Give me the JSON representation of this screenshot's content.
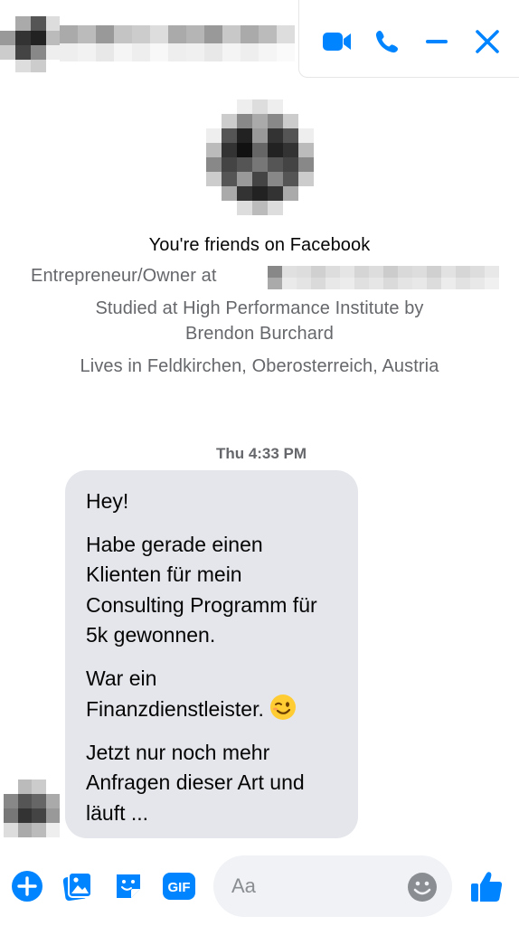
{
  "header": {
    "name_hidden": true,
    "actions": [
      "video-call",
      "audio-call",
      "minimize",
      "close"
    ],
    "accent_color": "#0084ff"
  },
  "profile": {
    "friends_text": "You're friends on Facebook",
    "work_text": "Entrepreneur/Owner at",
    "study_line1": "Studied at High Performance Institute by",
    "study_line2": "Brendon Burchard",
    "lives_text": "Lives in Feldkirchen, Oberosterreich, Austria"
  },
  "conversation": {
    "timestamp": "Thu 4:33 PM",
    "messages": [
      "Hey!",
      "Habe gerade einen Klienten für mein Consulting Programm für 5k gewonnen.",
      "War ein Finanzdienstleister.",
      "Jetzt nur noch mehr Anfragen dieser Art und läuft ..."
    ],
    "emoji": "winking-face"
  },
  "composer": {
    "placeholder": "Aa",
    "buttons": [
      "more-actions",
      "attach-image",
      "sticker",
      "gif",
      "emoji",
      "like"
    ]
  }
}
